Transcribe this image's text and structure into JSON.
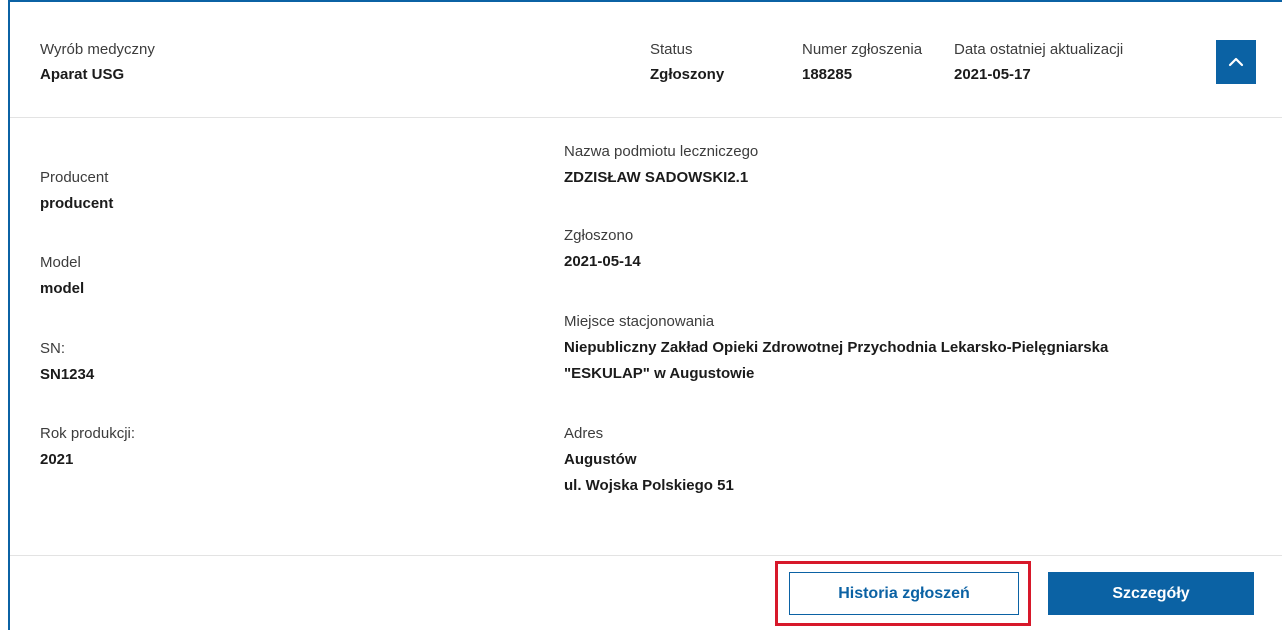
{
  "header": {
    "device": {
      "label": "Wyrób medyczny",
      "value": "Aparat USG"
    },
    "status": {
      "label": "Status",
      "value": "Zgłoszony"
    },
    "report_number": {
      "label": "Numer zgłoszenia",
      "value": "188285"
    },
    "last_update": {
      "label": "Data ostatniej aktualizacji",
      "value": "2021-05-17"
    },
    "collapse_icon": "chevron-up-icon"
  },
  "left": {
    "producer": {
      "label": "Producent",
      "value": "producent"
    },
    "model": {
      "label": "Model",
      "value": "model"
    },
    "sn": {
      "label": "SN:",
      "value": "SN1234"
    },
    "year": {
      "label": "Rok produkcji:",
      "value": "2021"
    }
  },
  "right": {
    "facility_name": {
      "label": "Nazwa podmiotu leczniczego",
      "value": "ZDZISŁAW SADOWSKI2.1"
    },
    "reported": {
      "label": "Zgłoszono",
      "value": "2021-05-14"
    },
    "location": {
      "label": "Miejsce stacjonowania",
      "line1": "Niepubliczny Zakład Opieki Zdrowotnej Przychodnia Lekarsko-Pielęgniarska",
      "line2": "\"ESKULAP\" w Augustowie"
    },
    "address": {
      "label": "Adres",
      "line1": "Augustów",
      "line2": "ul. Wojska Polskiego 51"
    }
  },
  "footer": {
    "history_label": "Historia zgłoszeń",
    "details_label": "Szczegóły"
  },
  "colors": {
    "primary": "#0b62a4",
    "highlight": "#d7182a"
  }
}
